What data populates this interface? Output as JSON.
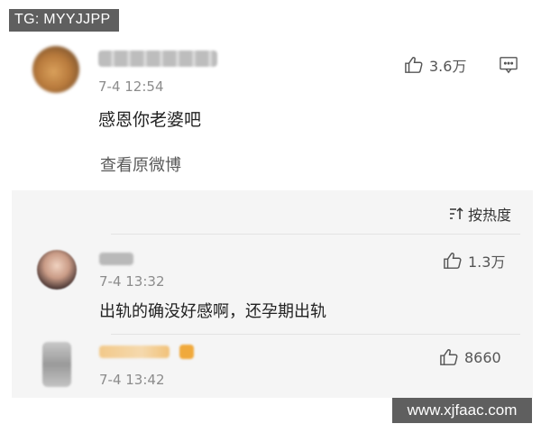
{
  "watermark_top": "TG: MYYJJPP",
  "watermark_bottom": "www.xjfaac.com",
  "main_comment": {
    "time": "7-4 12:54",
    "text": "感恩你老婆吧",
    "likes": "3.6万",
    "view_original": "查看原微博"
  },
  "sort": {
    "label": "按热度"
  },
  "replies": [
    {
      "time": "7-4 13:32",
      "text": "出轨的确没好感啊，还孕期出轨",
      "likes": "1.3万"
    },
    {
      "time": "7-4 13:42",
      "text": "",
      "likes": "8660"
    }
  ],
  "colors": {
    "reply_bg": "#f5f5f5",
    "watermark_bg": "#5f5f5f",
    "meta_gray": "#8c8c8c"
  },
  "icons": {
    "like": "thumbs-up-icon",
    "comment": "comment-icon",
    "sort": "sort-icon"
  }
}
